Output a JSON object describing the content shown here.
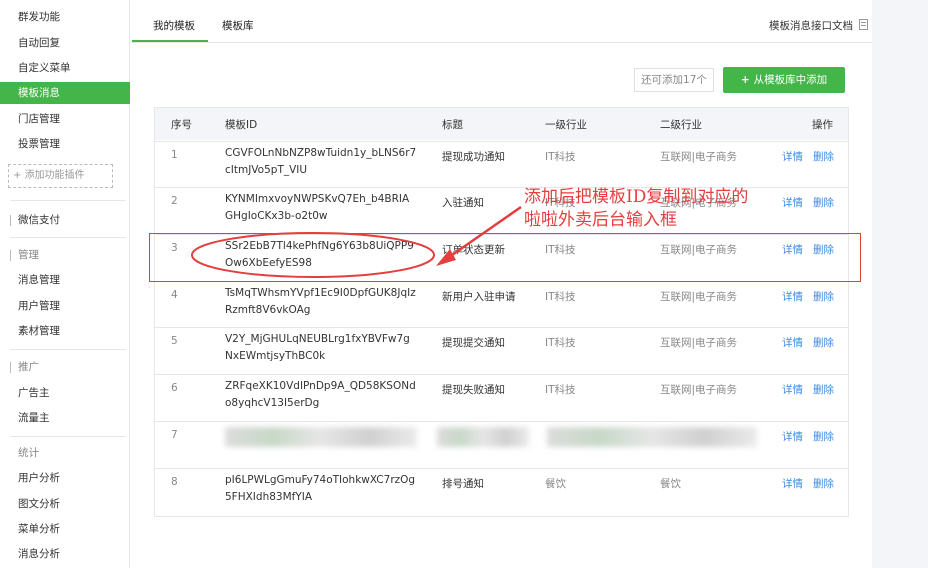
{
  "sidebar": {
    "items": [
      {
        "label": "群发功能"
      },
      {
        "label": "自动回复"
      },
      {
        "label": "自定义菜单"
      },
      {
        "label": "模板消息"
      },
      {
        "label": "门店管理"
      },
      {
        "label": "投票管理"
      }
    ],
    "plugin_label": "+ 添加功能插件",
    "wechat_pay": "微信支付",
    "manage_head": "管理",
    "manage_items": [
      {
        "label": "消息管理"
      },
      {
        "label": "用户管理"
      },
      {
        "label": "素材管理"
      }
    ],
    "promo_head": "推广",
    "promo_items": [
      {
        "label": "广告主"
      },
      {
        "label": "流量主"
      }
    ],
    "stats_head": "统计",
    "stats_items": [
      {
        "label": "用户分析"
      },
      {
        "label": "图文分析"
      },
      {
        "label": "菜单分析"
      },
      {
        "label": "消息分析"
      }
    ]
  },
  "tabs": {
    "my_templates": "我的模板",
    "template_library": "模板库"
  },
  "doc_link": "模板消息接口文档",
  "remaining": "还可添加17个",
  "add_button": "从模板库中添加",
  "table": {
    "headers": {
      "seq": "序号",
      "template_id": "模板ID",
      "title": "标题",
      "industry1": "一级行业",
      "industry2": "二级行业",
      "action": "操作"
    },
    "rows": [
      {
        "seq": "1",
        "id1": "CGVFOLnNbNZP8wTuidn1y_bLNS6r7",
        "id2": "cItmJVo5pT_VIU",
        "title": "提现成功通知",
        "ind1": "IT科技",
        "ind2": "互联网|电子商务",
        "detail": "详情",
        "delete": "删除"
      },
      {
        "seq": "2",
        "id1": "KYNMImxvoyNWPSKvQ7Eh_b4BRIA",
        "id2": "GHgIoCKx3b-o2t0w",
        "title": "入驻通知",
        "ind1": "IT科技",
        "ind2": "互联网|电子商务",
        "detail": "详情",
        "delete": "删除"
      },
      {
        "seq": "3",
        "id1": "SSr2EbB7Tl4kePhfNg6Y63b8UiQPP9",
        "id2": "Ow6XbEefyES98",
        "title": "订单状态更新",
        "ind1": "IT科技",
        "ind2": "互联网|电子商务",
        "detail": "详情",
        "delete": "删除"
      },
      {
        "seq": "4",
        "id1": "TsMqTWhsmYVpf1Ec9I0DpfGUK8JqIz",
        "id2": "Rzmft8V6vkOAg",
        "title": "新用户入驻申请",
        "ind1": "IT科技",
        "ind2": "互联网|电子商务",
        "detail": "详情",
        "delete": "删除"
      },
      {
        "seq": "5",
        "id1": "V2Y_MjGHULqNEUBLrg1fxYBVFw7g",
        "id2": "NxEWmtjsyThBC0k",
        "title": "提现提交通知",
        "ind1": "IT科技",
        "ind2": "互联网|电子商务",
        "detail": "详情",
        "delete": "删除"
      },
      {
        "seq": "6",
        "id1": "ZRFqeXK10VdIPnDp9A_QD58KSONd",
        "id2": "o8yqhcV13I5erDg",
        "title": "提现失败通知",
        "ind1": "IT科技",
        "ind2": "互联网|电子商务",
        "detail": "详情",
        "delete": "删除"
      },
      {
        "seq": "7",
        "id1": "",
        "id2": "",
        "title": "",
        "ind1": "",
        "ind2": "",
        "detail": "详情",
        "delete": "删除"
      },
      {
        "seq": "8",
        "id1": "pI6LPWLgGmuFy74oTIohkwXC7rzOg",
        "id2": "5FHXIdh83MfYIA",
        "title": "排号通知",
        "ind1": "餐饮",
        "ind2": "餐饮",
        "detail": "详情",
        "delete": "删除"
      }
    ]
  },
  "annotation": {
    "line1": "添加后把模板ID复制到对应的",
    "line2": "啦啦外卖后台输入框",
    "color": "#e53e3e"
  },
  "colors": {
    "accent": "#44b549",
    "link": "#3e8ae4",
    "annotation": "#e53e3e"
  }
}
